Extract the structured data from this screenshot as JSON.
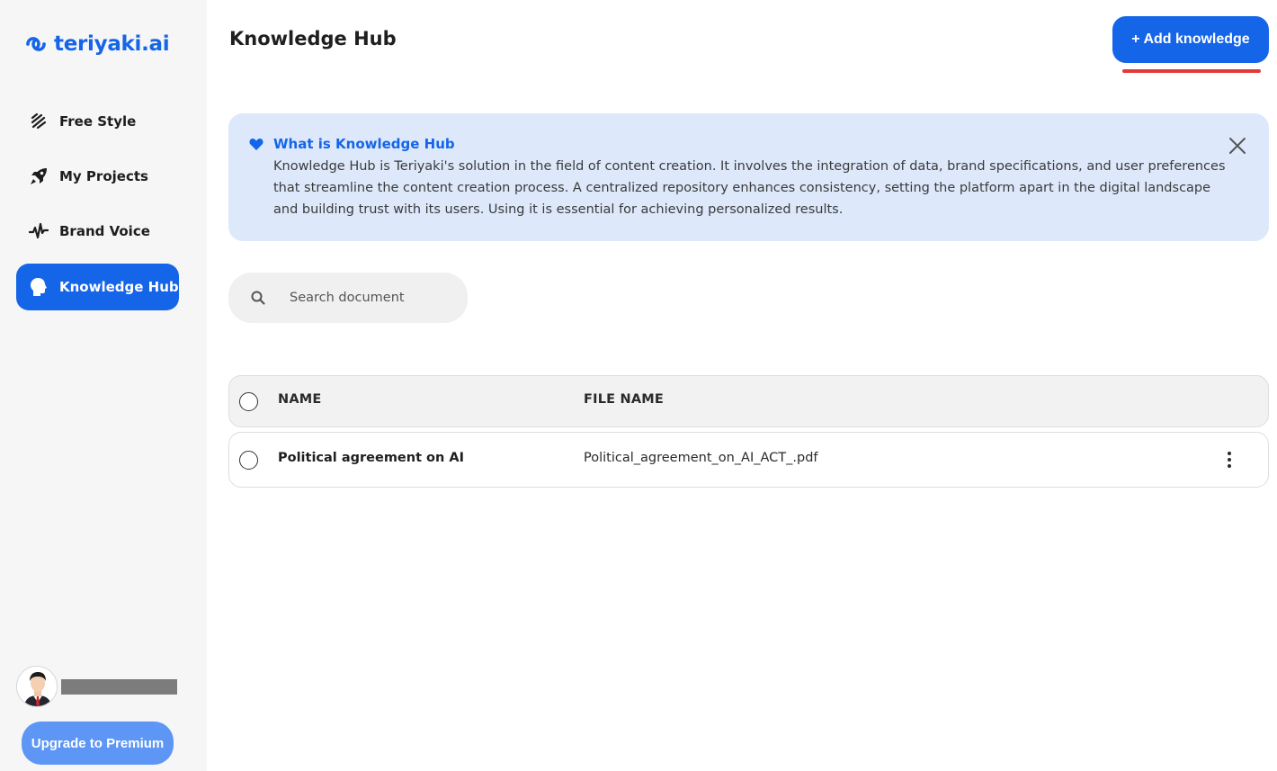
{
  "brand": {
    "name": "teriyaki.ai",
    "accent_color": "#1565e8"
  },
  "sidebar": {
    "items": [
      {
        "label": "Free Style",
        "icon": "free-style-icon",
        "active": false
      },
      {
        "label": "My Projects",
        "icon": "rocket-icon",
        "active": false
      },
      {
        "label": "Brand Voice",
        "icon": "waveform-icon",
        "active": false
      },
      {
        "label": "Knowledge Hub",
        "icon": "head-icon",
        "active": true
      }
    ],
    "user": {
      "avatar": "avatar-icon"
    },
    "upgrade_label": "Upgrade to Premium"
  },
  "header": {
    "title": "Knowledge Hub",
    "add_button_label": "+ Add knowledge",
    "annotation_color": "#e23a3a"
  },
  "info": {
    "title": "What is Knowledge Hub",
    "text": "Knowledge Hub is Teriyaki's solution in the field of content creation. It involves the integration of data, brand specifications, and user preferences that streamline the content creation process. A centralized repository enhances consistency, setting the platform apart in the digital landscape and building trust with its users. Using it is essential for achieving personalized results.",
    "background_color": "#dde9fb"
  },
  "search": {
    "placeholder": "Search document",
    "value": ""
  },
  "table": {
    "columns": [
      "NAME",
      "FILE NAME"
    ],
    "rows": [
      {
        "name": "Political agreement on AI",
        "file_name": "Political_agreement_on_AI_ACT_.pdf"
      }
    ]
  }
}
